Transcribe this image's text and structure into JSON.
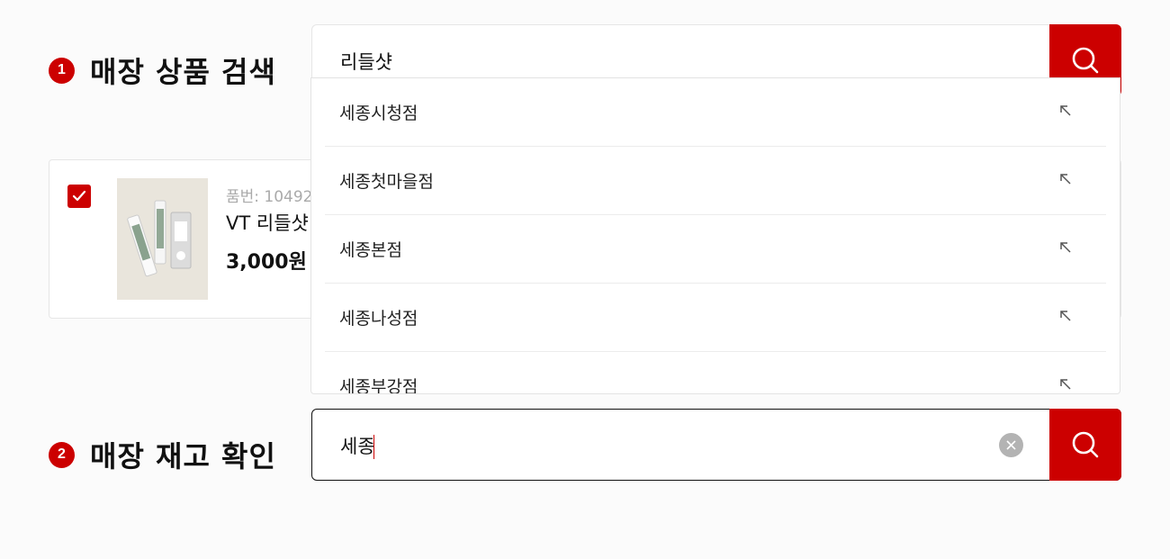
{
  "step1": {
    "number": "1",
    "title": "매장 상품 검색",
    "search_value": "리들샷",
    "search_button_icon": "search-icon"
  },
  "product": {
    "checked": true,
    "code": "품번: 10492",
    "name": "VT 리들샷",
    "price": "3,000원"
  },
  "dropdown": {
    "items": [
      {
        "label": "세종시청점",
        "icon": "arrow-up-left-icon"
      },
      {
        "label": "세종첫마을점",
        "icon": "arrow-up-left-icon"
      },
      {
        "label": "세종본점",
        "icon": "arrow-up-left-icon"
      },
      {
        "label": "세종나성점",
        "icon": "arrow-up-left-icon"
      },
      {
        "label": "세종부강점",
        "icon": "arrow-up-left-icon"
      }
    ]
  },
  "step2": {
    "number": "2",
    "title": "매장 재고 확인",
    "search_value": "세종",
    "clear_icon": "clear-icon",
    "search_button_icon": "search-icon"
  },
  "colors": {
    "accent": "#cc0000",
    "text": "#111111",
    "muted": "#aaaaaa",
    "border": "#e3e3e3",
    "clear": "#b3b3b3"
  }
}
